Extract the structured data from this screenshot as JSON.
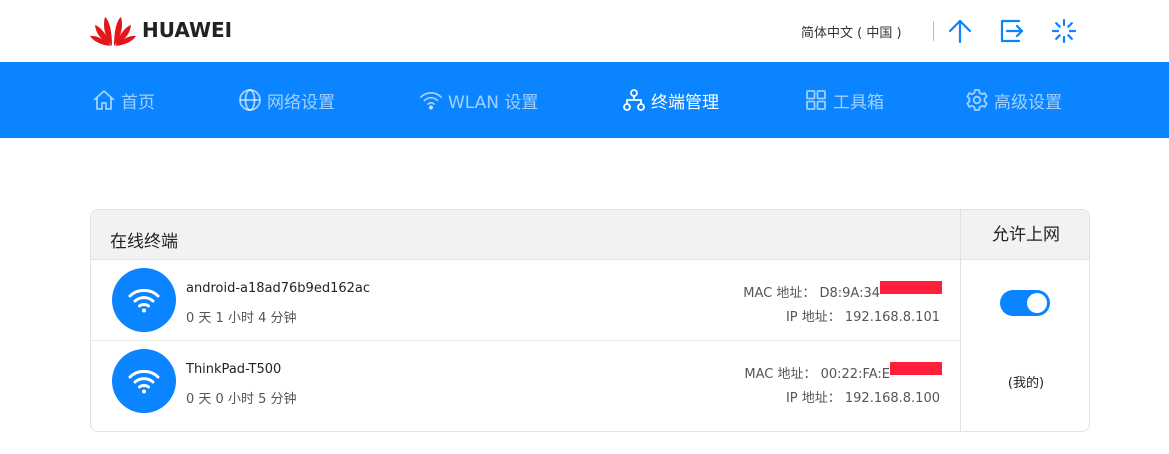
{
  "brand": {
    "name": "HUAWEI",
    "logo_color": "#e3161c"
  },
  "header": {
    "language": "简体中文 ( 中国 )",
    "icons": [
      "upload-arrow-icon",
      "logout-icon",
      "loading-spinner-icon"
    ]
  },
  "nav": {
    "accent": "#0a84ff",
    "items": [
      {
        "label": "首页",
        "icon": "home-icon",
        "active": false
      },
      {
        "label": "网络设置",
        "icon": "globe-icon",
        "active": false
      },
      {
        "label": "WLAN 设置",
        "icon": "wifi-icon",
        "active": false
      },
      {
        "label": "终端管理",
        "icon": "network-tree-icon",
        "active": true
      },
      {
        "label": "工具箱",
        "icon": "grid-icon",
        "active": false
      },
      {
        "label": "高级设置",
        "icon": "gear-icon",
        "active": false
      }
    ]
  },
  "devices_panel": {
    "title": "在线终端",
    "allow_column_title": "允许上网",
    "devices": [
      {
        "name": "android-a18ad76b9ed162ac",
        "duration": "0 天 1 小时 4 分钟",
        "mac_label": "MAC 地址：",
        "mac_visible": "D8:9A:34",
        "ip_label": "IP 地址：",
        "ip": "192.168.8.101",
        "allowed": true
      },
      {
        "name": "ThinkPad-T500",
        "duration": "0 天 0 小时 5 分钟",
        "mac_label": "MAC 地址：",
        "mac_visible": "00:22:FA:E",
        "ip_label": "IP 地址：",
        "ip": "192.168.8.100",
        "self_label": "(我的)"
      }
    ]
  }
}
